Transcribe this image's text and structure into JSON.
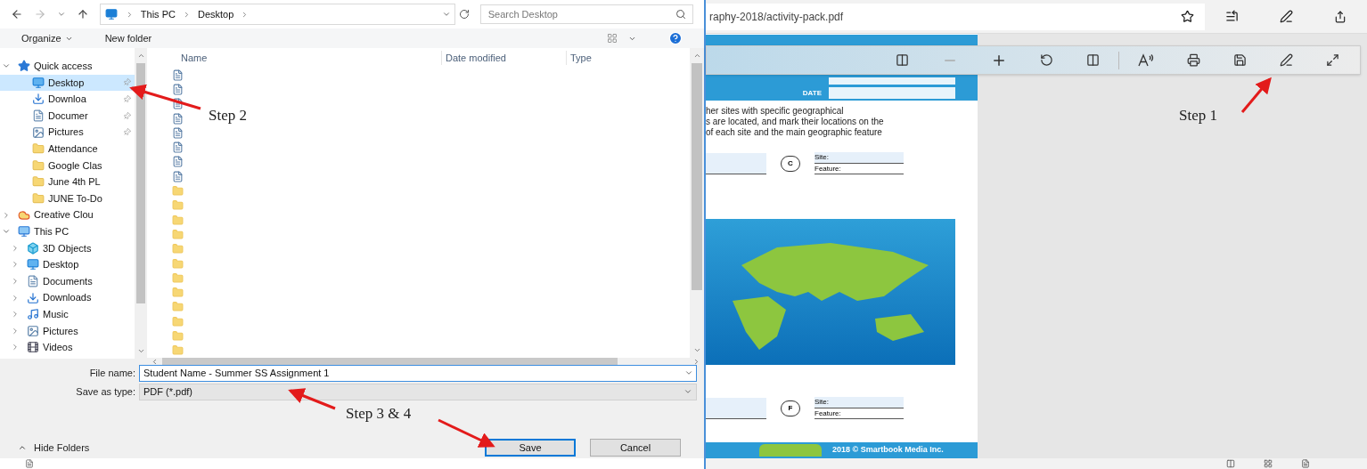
{
  "dialog": {
    "breadcrumb": [
      "This PC",
      "Desktop"
    ],
    "search": {
      "placeholder": "Search Desktop"
    },
    "toolbar": {
      "organize": "Organize",
      "new_folder": "New folder"
    },
    "nav": [
      {
        "label": "Quick access",
        "kind": "star",
        "expanded": true,
        "selected": false,
        "children": [
          {
            "label": "Desktop",
            "kind": "desktop",
            "pinned": true,
            "selected": true
          },
          {
            "label": "Downloa",
            "kind": "download",
            "pinned": true,
            "selected": false
          },
          {
            "label": "Documer",
            "kind": "documents",
            "pinned": true,
            "selected": false
          },
          {
            "label": "Pictures",
            "kind": "pictures",
            "pinned": true,
            "selected": false
          },
          {
            "label": "Attendance",
            "kind": "folder",
            "pinned": false,
            "selected": false
          },
          {
            "label": "Google Clas",
            "kind": "folder",
            "pinned": false,
            "selected": false
          },
          {
            "label": "June 4th PL",
            "kind": "folder",
            "pinned": false,
            "selected": false
          },
          {
            "label": "JUNE To-Do",
            "kind": "folder",
            "pinned": false,
            "selected": false
          }
        ]
      },
      {
        "label": "Creative Clou",
        "kind": "cloud",
        "expanded": false,
        "selected": false
      },
      {
        "label": "This PC",
        "kind": "pc",
        "expanded": true,
        "selected": false,
        "children": [
          {
            "label": "3D Objects",
            "kind": "objects",
            "expanded": false,
            "selected": false
          },
          {
            "label": "Desktop",
            "kind": "desktop",
            "expanded": false,
            "selected": false
          },
          {
            "label": "Documents",
            "kind": "documents",
            "expanded": false,
            "selected": false
          },
          {
            "label": "Downloads",
            "kind": "download",
            "expanded": false,
            "selected": false
          },
          {
            "label": "Music",
            "kind": "music",
            "expanded": false,
            "selected": false
          },
          {
            "label": "Pictures",
            "kind": "pictures",
            "expanded": false,
            "selected": false
          },
          {
            "label": "Videos",
            "kind": "videos",
            "expanded": false,
            "selected": false
          }
        ]
      }
    ],
    "columns": [
      "Name",
      "Date modified",
      "Type"
    ],
    "files": [
      {
        "kind": "document"
      },
      {
        "kind": "document"
      },
      {
        "kind": "document"
      },
      {
        "kind": "document"
      },
      {
        "kind": "document"
      },
      {
        "kind": "document"
      },
      {
        "kind": "document"
      },
      {
        "kind": "document"
      },
      {
        "kind": "folder"
      },
      {
        "kind": "folder"
      },
      {
        "kind": "folder"
      },
      {
        "kind": "folder"
      },
      {
        "kind": "folder"
      },
      {
        "kind": "folder"
      },
      {
        "kind": "folder"
      },
      {
        "kind": "folder"
      },
      {
        "kind": "folder"
      },
      {
        "kind": "folder"
      },
      {
        "kind": "folder"
      },
      {
        "kind": "folder"
      }
    ],
    "file_name": {
      "label": "File name:",
      "value": "Student Name - Summer SS Assignment 1"
    },
    "save_as_type": {
      "label": "Save as type:",
      "value": "PDF (*.pdf)"
    },
    "hide_folders": "Hide Folders",
    "buttons": [
      {
        "label": "Save",
        "default": true
      },
      {
        "label": "Cancel",
        "default": false
      }
    ]
  },
  "browser": {
    "address": "raphy-2018/activity-pack.pdf",
    "pdf": {
      "date_label": "DATE",
      "intro": [
        "her sites with specific geographical",
        "s are located, and mark their locations on the",
        "of each site and the main geographic feature"
      ],
      "sites": [
        {
          "letter": "C",
          "site": "Site:",
          "feature": "Feature:"
        },
        {
          "letter": "F",
          "site": "Site:",
          "feature": "Feature:"
        }
      ],
      "footer": "2018 © Smartbook Media Inc."
    }
  },
  "annotations": [
    {
      "text": "Step 1"
    },
    {
      "text": "Step 2"
    },
    {
      "text": "Step 3 & 4"
    }
  ]
}
